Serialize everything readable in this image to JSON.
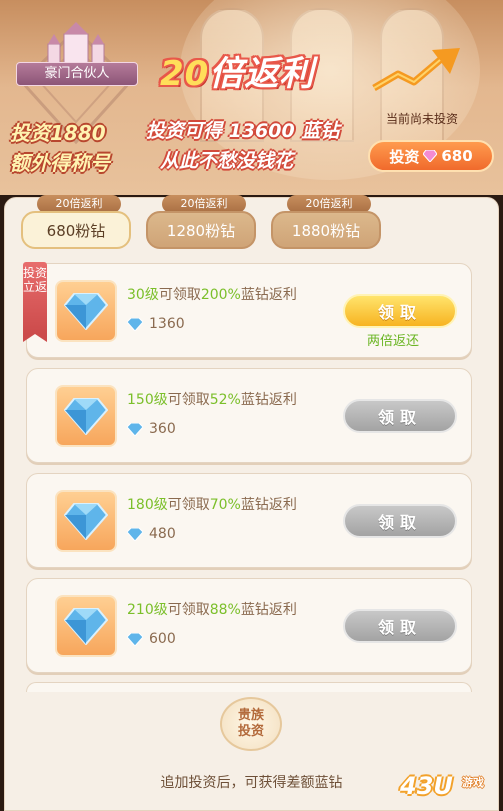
{
  "banner": {
    "emblem_label": "豪门合伙人",
    "title_prefix": "20",
    "title_suffix": "倍返利",
    "invest_amount_line": "投资1880",
    "extra_title_line": "额外得称号",
    "slogan_line1": "投资可得 13600 蓝钻",
    "slogan_line2": "从此不愁没钱花",
    "status": "当前尚未投资",
    "invest_button_label": "投资",
    "invest_button_value": "680"
  },
  "tabs": [
    {
      "badge": "20倍返利",
      "label": "680粉钻",
      "active": true
    },
    {
      "badge": "20倍返利",
      "label": "1280粉钻",
      "active": false
    },
    {
      "badge": "20倍返利",
      "label": "1880粉钻",
      "active": false
    }
  ],
  "ribbon": "投资立返",
  "rewards": [
    {
      "level": "30级",
      "mid": "可领取",
      "percent": "200%",
      "tail": "蓝钻返利",
      "amount": "1360",
      "button": "领取",
      "enabled": true,
      "note": "两倍返还"
    },
    {
      "level": "150级",
      "mid": "可领取",
      "percent": "52%",
      "tail": "蓝钻返利",
      "amount": "360",
      "button": "领取",
      "enabled": false,
      "note": ""
    },
    {
      "level": "180级",
      "mid": "可领取",
      "percent": "70%",
      "tail": "蓝钻返利",
      "amount": "480",
      "button": "领取",
      "enabled": false,
      "note": ""
    },
    {
      "level": "210级",
      "mid": "可领取",
      "percent": "88%",
      "tail": "蓝钻返利",
      "amount": "600",
      "button": "领取",
      "enabled": false,
      "note": ""
    }
  ],
  "noble_button": "贵族投资",
  "footer_text": "追加投资后，可获得差额蓝钻",
  "watermark": {
    "main": "43U",
    "sub": "游戏"
  },
  "colors": {
    "accent_green": "#7bbf2a",
    "claim_gold": "#f7b321",
    "disabled_gray": "#a3a3a3",
    "banner_red": "#e8584a"
  },
  "icons": [
    "diamond-icon",
    "pink-diamond-icon",
    "rising-arrow-icon",
    "castle-emblem-icon"
  ]
}
